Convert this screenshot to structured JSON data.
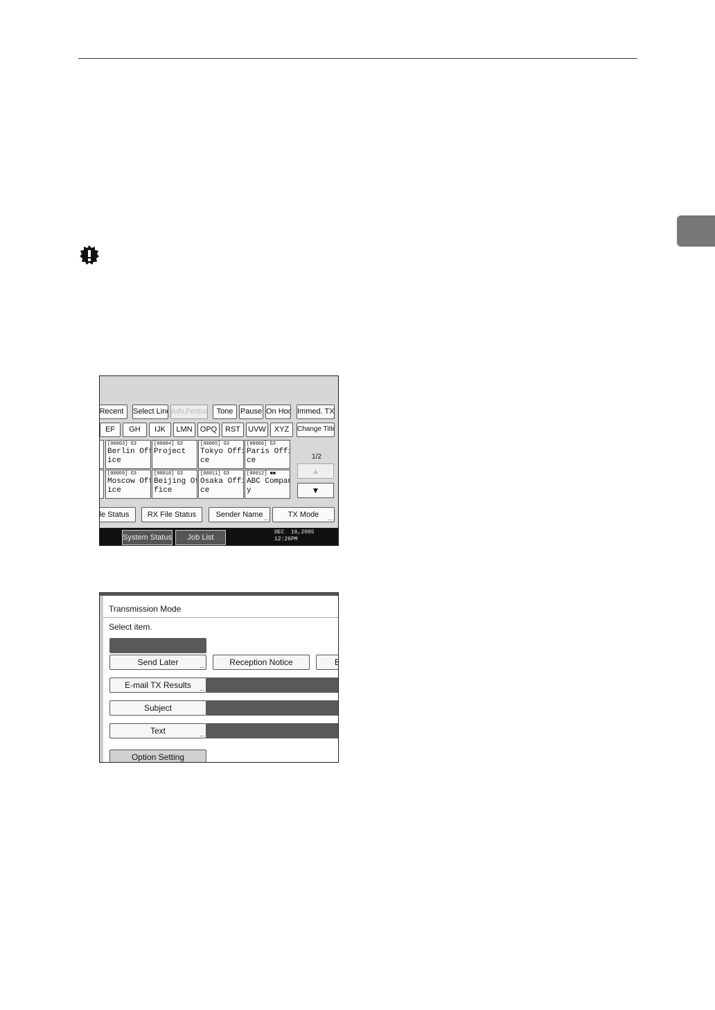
{
  "screen1": {
    "row1": [
      "Recent",
      "Select Line",
      "Adv.Features",
      "Tone",
      "Pause",
      "On Hook",
      "Immed. TX"
    ],
    "row2": [
      "EF",
      "GH",
      "IJK",
      "LMN",
      "OPQ",
      "RST",
      "UVW",
      "XYZ",
      "Change Title"
    ],
    "destinations": [
      {
        "code": "[00003] G3",
        "name": "Berlin Off\nice"
      },
      {
        "code": "[00004] G3",
        "name": "Project"
      },
      {
        "code": "[00005] G3",
        "name": "Tokyo Offi\nce"
      },
      {
        "code": "[00006] G3",
        "name": "Paris Offi\nce"
      },
      {
        "code": "[00009] G3",
        "name": "Moscow Off\nice"
      },
      {
        "code": "[00010] G3",
        "name": "Beijing Of\nfice"
      },
      {
        "code": "[00011] G3",
        "name": "Osaka Offi\nce"
      },
      {
        "code": "[00012]",
        "name": "ABC Compan\ny"
      }
    ],
    "page_indicator": "1/2",
    "up_arrow": "▲",
    "down_arrow": "▼",
    "bottom_buttons": [
      "le Status",
      "RX File Status",
      "Sender Name",
      "TX Mode"
    ],
    "system_status": "System Status",
    "job_list": "Job List",
    "date": "DEC  16,2005",
    "time": "12:26PM"
  },
  "screen2": {
    "title": "Transmission Mode",
    "subtitle": "Select item.",
    "send_later": "Send Later",
    "reception_notice": "Reception Notice",
    "partial_button": "B",
    "email_tx_results": "E-mail TX Results",
    "subject": "Subject",
    "text": "Text",
    "option_setting": "Option Setting"
  }
}
